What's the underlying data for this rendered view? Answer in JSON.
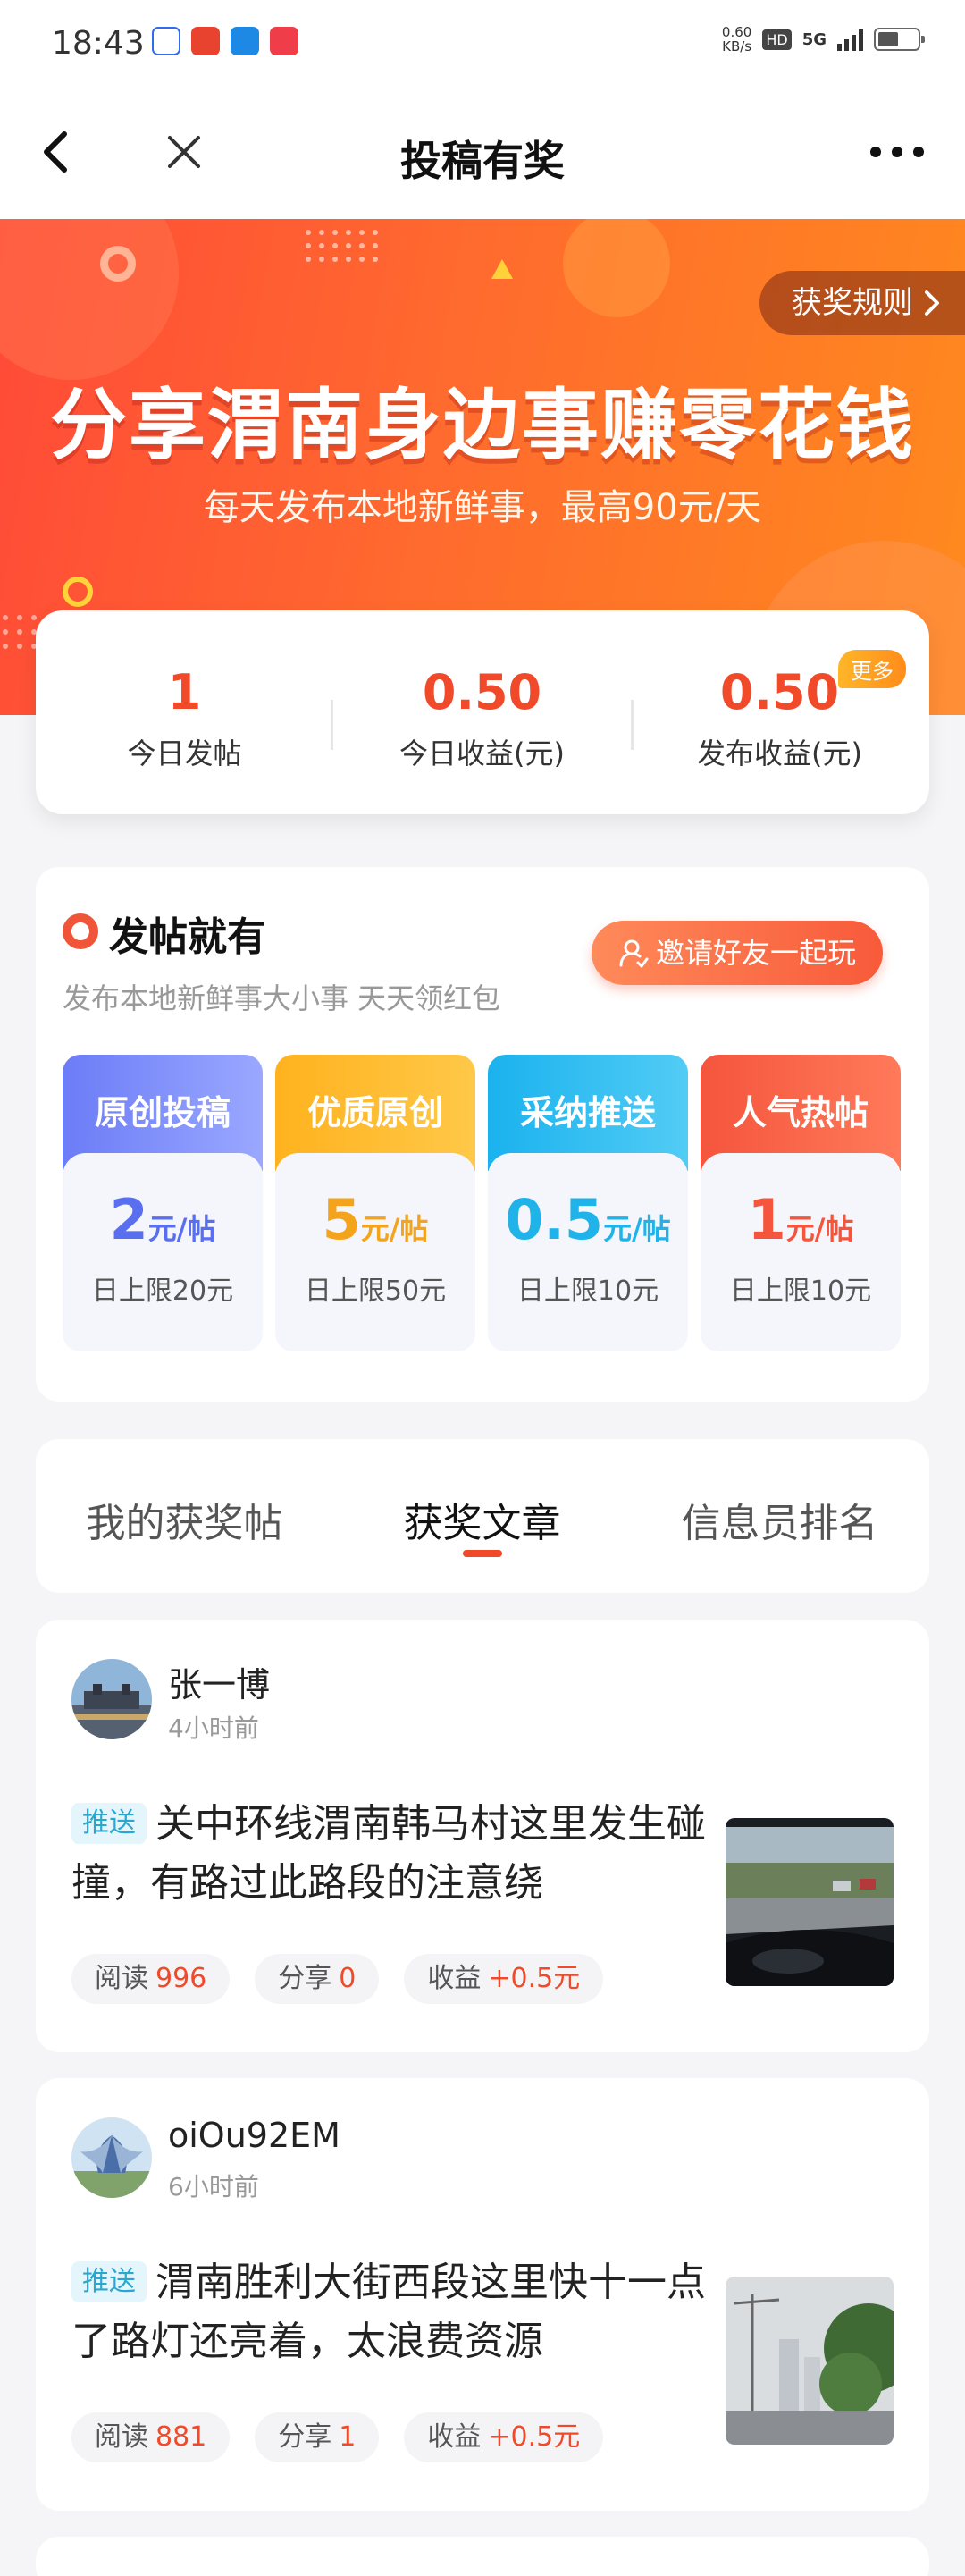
{
  "status_bar": {
    "time": "18:43",
    "net_speed_value": "0.60",
    "net_speed_unit": "KB/s",
    "hd": "HD",
    "network": "5G"
  },
  "nav": {
    "title": "投稿有奖"
  },
  "hero": {
    "rules_label": "获奖规则",
    "title": "分享渭南身边事赚零花钱",
    "subtitle": "每天发布本地新鲜事，最高90元/天"
  },
  "stats": [
    {
      "value": "1",
      "label": "今日发帖"
    },
    {
      "value": "0.50",
      "label": "今日收益(元)"
    },
    {
      "value": "0.50",
      "label": "发布收益(元)"
    }
  ],
  "stats_more_badge": "更多",
  "rewards": {
    "title": "发帖就有",
    "subtitle": "发布本地新鲜事大小事 天天领红包",
    "invite_label": "邀请好友一起玩",
    "tiers": [
      {
        "name": "原创投稿",
        "amount": "2",
        "unit": "元/帖",
        "limit": "日上限20元",
        "color": "#5a6ff0"
      },
      {
        "name": "优质原创",
        "amount": "5",
        "unit": "元/帖",
        "limit": "日上限50元",
        "color": "#f4a31c"
      },
      {
        "name": "采纳推送",
        "amount": "0.5",
        "unit": "元/帖",
        "limit": "日上限10元",
        "color": "#1fb3ea"
      },
      {
        "name": "人气热帖",
        "amount": "1",
        "unit": "元/帖",
        "limit": "日上限10元",
        "color": "#f5553d"
      }
    ]
  },
  "tabs": [
    {
      "label": "我的获奖帖",
      "active": false
    },
    {
      "label": "获奖文章",
      "active": true
    },
    {
      "label": "信息员排名",
      "active": false
    }
  ],
  "articles": [
    {
      "author": "张一博",
      "time": "4小时前",
      "tag": "推送",
      "title": "关中环线渭南韩马村这里发生碰撞，有路过此路段的注意绕",
      "metrics": [
        {
          "label": "阅读",
          "value": "996"
        },
        {
          "label": "分享",
          "value": "0"
        },
        {
          "label": "收益",
          "value": "+0.5元"
        }
      ]
    },
    {
      "author": "oiOu92EM",
      "time": "6小时前",
      "tag": "推送",
      "title": "渭南胜利大街西段这里快十一点了路灯还亮着，太浪费资源",
      "metrics": [
        {
          "label": "阅读",
          "value": "881"
        },
        {
          "label": "分享",
          "value": "1"
        },
        {
          "label": "收益",
          "value": "+0.5元"
        }
      ]
    }
  ]
}
